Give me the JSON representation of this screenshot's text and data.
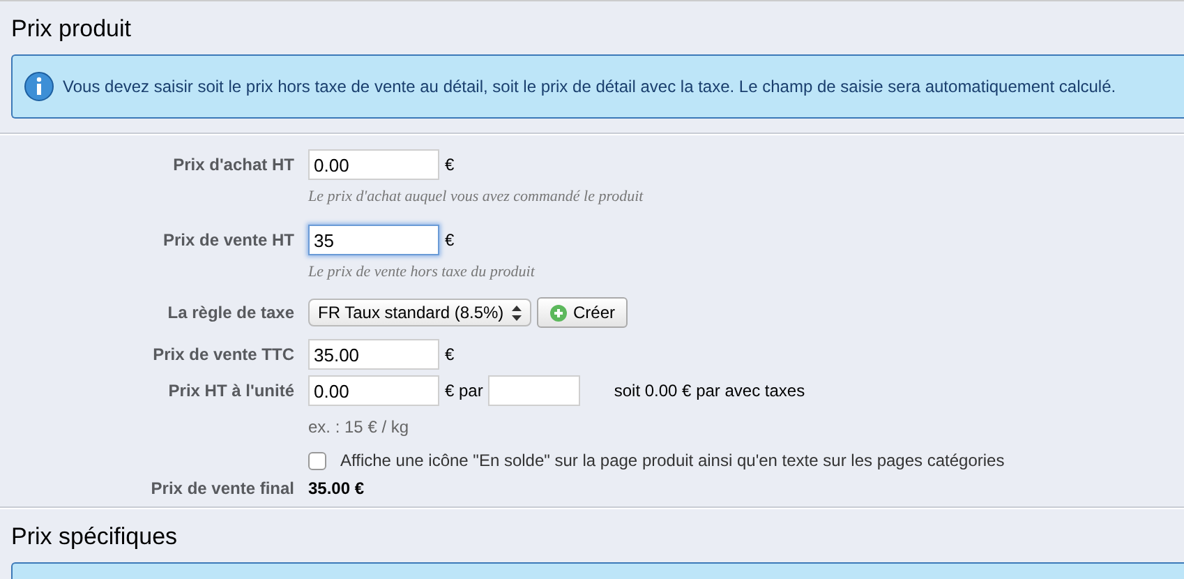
{
  "sections": [
    {
      "title": "Prix produit",
      "info": "Vous devez saisir soit le prix hors taxe de vente au détail, soit le prix de détail avec la taxe. Le champ de saisie sera automatiquement calculé.",
      "rows": [
        {
          "kind": "input",
          "label": "Prix d'achat HT",
          "value": "0.00",
          "focused": false,
          "unit": "€",
          "hint": "Le prix d'achat auquel vous avez commandé le produit"
        },
        {
          "kind": "input",
          "label": "Prix de vente HT",
          "value": "35",
          "focused": true,
          "unit": "€",
          "hint": "Le prix de vente hors taxe du produit"
        },
        {
          "kind": "select",
          "label": "La règle de taxe",
          "value": "FR Taux standard (8.5%)",
          "button": "Créer"
        },
        {
          "kind": "input",
          "label": "Prix de vente TTC",
          "value": "35.00",
          "focused": false,
          "unit": "€"
        },
        {
          "kind": "unit_price",
          "label": "Prix HT à l'unité",
          "value": "0.00",
          "unit": "€ par",
          "note": "soit 0.00 € par avec taxes",
          "hint": "ex. : 15 € / kg"
        },
        {
          "kind": "checkbox",
          "label": "Affiche une icône \"En solde\" sur la page produit ainsi qu'en texte sur les pages catégories",
          "checked": false
        },
        {
          "kind": "final",
          "label": "Prix de vente final",
          "value": "35.00 €"
        }
      ]
    },
    {
      "title": "Prix spécifiques",
      "info_box_partial": true
    }
  ]
}
